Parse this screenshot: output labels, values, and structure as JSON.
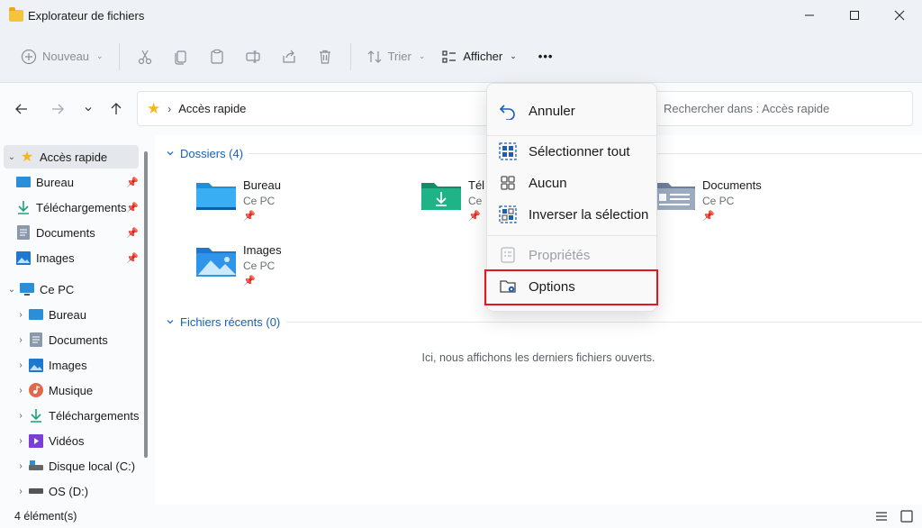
{
  "window": {
    "title": "Explorateur de fichiers"
  },
  "toolbar": {
    "new_label": "Nouveau",
    "sort_label": "Trier",
    "view_label": "Afficher",
    "more_label": "•••"
  },
  "address": {
    "crumb": "Accès rapide",
    "search_placeholder": "Rechercher dans : Accès rapide"
  },
  "sidebar": {
    "quick_access": "Accès rapide",
    "quick_items": [
      {
        "label": "Bureau",
        "icon": "desktop-icon"
      },
      {
        "label": "Téléchargements",
        "icon": "download-icon"
      },
      {
        "label": "Documents",
        "icon": "documents-icon"
      },
      {
        "label": "Images",
        "icon": "pictures-icon"
      }
    ],
    "this_pc": "Ce PC",
    "pc_items": [
      {
        "label": "Bureau",
        "icon": "desktop-icon"
      },
      {
        "label": "Documents",
        "icon": "documents-icon"
      },
      {
        "label": "Images",
        "icon": "pictures-icon"
      },
      {
        "label": "Musique",
        "icon": "music-icon"
      },
      {
        "label": "Téléchargements",
        "icon": "download-icon"
      },
      {
        "label": "Vidéos",
        "icon": "videos-icon"
      },
      {
        "label": "Disque local (C:)",
        "icon": "drive-icon"
      },
      {
        "label": "OS (D:)",
        "icon": "drive-icon"
      }
    ]
  },
  "main": {
    "folders_header": "Dossiers (4)",
    "folders": [
      {
        "name": "Bureau",
        "sub": "Ce PC"
      },
      {
        "name": "Téléchargements",
        "sub": "Ce PC"
      },
      {
        "name": "Documents",
        "sub": "Ce PC"
      },
      {
        "name": "Images",
        "sub": "Ce PC"
      }
    ],
    "recent_header": "Fichiers récents (0)",
    "empty_message": "Ici, nous affichons les derniers fichiers ouverts."
  },
  "menu": {
    "undo": "Annuler",
    "select_all": "Sélectionner tout",
    "select_none": "Aucun",
    "invert": "Inverser la sélection",
    "properties": "Propriétés",
    "options": "Options"
  },
  "status": {
    "count": "4 élément(s)"
  },
  "colors": {
    "accent": "#1a5fb4",
    "highlight": "#e5161c",
    "folder_blue": "#1e90d8",
    "folder_green": "#1aa37a"
  }
}
